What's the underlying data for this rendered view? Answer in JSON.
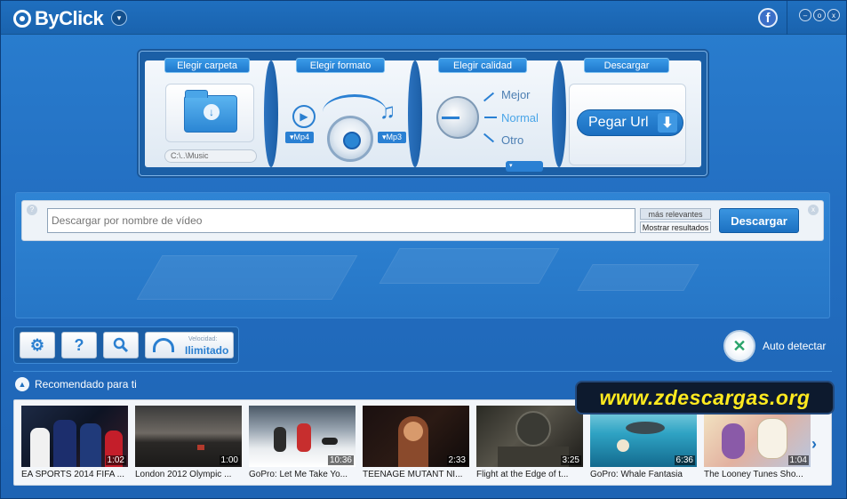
{
  "app": {
    "title": "ByClick"
  },
  "titlebar": {
    "facebook_letter": "f",
    "minimize": "–",
    "maximize": "o",
    "close": "x",
    "menu_caret": "▾"
  },
  "format_panel": {
    "folder_tab": "Elegir carpeta",
    "format_tab": "Elegir formato",
    "quality_tab": "Elegir calidad",
    "download_tab": "Descargar",
    "folder_path": "C:\\..\\Music",
    "video_format": "Mp4",
    "audio_format": "Mp3",
    "quality_options": [
      "Mejor",
      "Normal",
      "Otro"
    ],
    "paste_url_label": "Pegar Url"
  },
  "search": {
    "help": "?",
    "close": "x",
    "placeholder": "Descargar por nombre de vídeo",
    "sort_top": "más relevantes",
    "sort_bottom": "Mostrar resultados",
    "button_label": "Descargar"
  },
  "toolbar": {
    "help_label": "?",
    "speed_label": "Velocidad:",
    "speed_value": "Ilimitado"
  },
  "auto_detect": {
    "label": "Auto detectar"
  },
  "recommended": {
    "title": "Recomendado para ti",
    "videos": [
      {
        "title": "EA SPORTS 2014 FIFA ...",
        "duration": "1:02"
      },
      {
        "title": "London 2012 Olympic ...",
        "duration": "1:00"
      },
      {
        "title": "GoPro: Let Me Take Yo...",
        "duration": "10:36"
      },
      {
        "title": "TEENAGE MUTANT NI...",
        "duration": "2:33"
      },
      {
        "title": "Flight at the Edge of t...",
        "duration": "3:25"
      },
      {
        "title": "GoPro: Whale Fantasia",
        "duration": "6:36"
      },
      {
        "title": "The Looney Tunes Sho...",
        "duration": "1:04"
      }
    ]
  },
  "watermark": "www.zdescargas.org",
  "colors": {
    "accent": "#2a7fd0",
    "frame": "#1a5fae",
    "watermark_text": "#ffea1f"
  }
}
